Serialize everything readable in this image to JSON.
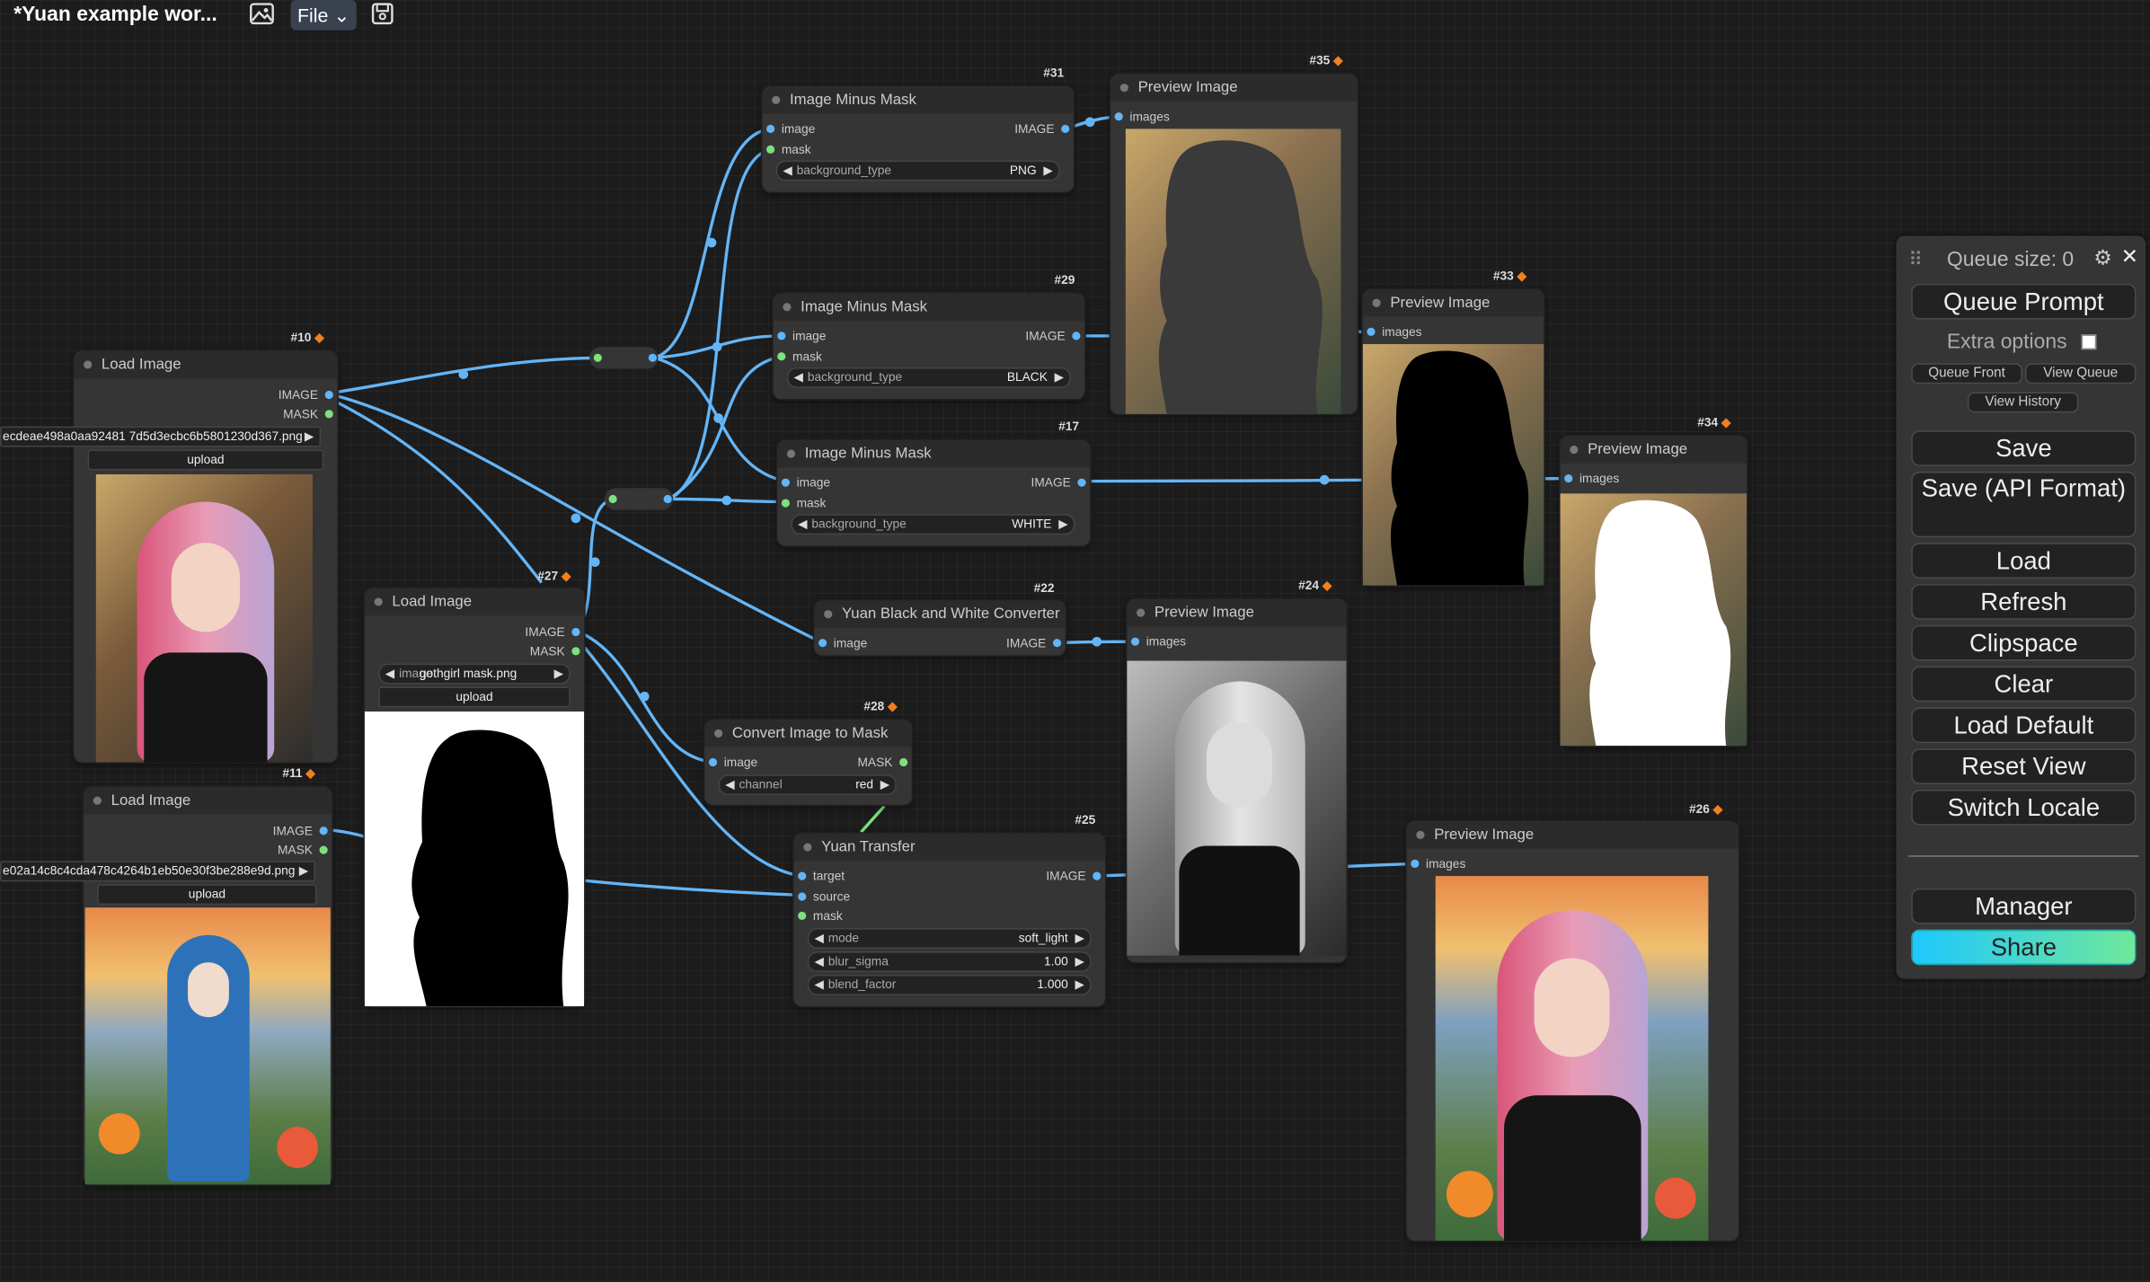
{
  "topbar": {
    "title": "*Yuan example wor...",
    "file_label": "File"
  },
  "nodes": {
    "n10": {
      "id": "#10",
      "title": "Load Image",
      "out_image": "IMAGE",
      "out_mask": "MASK",
      "filename": "ecdeae498a0aa92481 7d5d3ecbc6b5801230d367.png",
      "upload": "upload"
    },
    "n11": {
      "id": "#11",
      "title": "Load Image",
      "out_image": "IMAGE",
      "out_mask": "MASK",
      "filename": "e02a14c8c4cda478c4264b1eb50e30f3be288e9d.png",
      "upload": "upload"
    },
    "n27": {
      "id": "#27",
      "title": "Load Image",
      "out_image": "IMAGE",
      "out_mask": "MASK",
      "image_label": "image",
      "filename": "gothgirl mask.png",
      "upload": "upload"
    },
    "n31": {
      "id": "#31",
      "title": "Image Minus Mask",
      "in_image": "image",
      "in_mask": "mask",
      "out": "IMAGE",
      "w_label": "background_type",
      "w_value": "PNG"
    },
    "n29": {
      "id": "#29",
      "title": "Image Minus Mask",
      "in_image": "image",
      "in_mask": "mask",
      "out": "IMAGE",
      "w_label": "background_type",
      "w_value": "BLACK"
    },
    "n17": {
      "id": "#17",
      "title": "Image Minus Mask",
      "in_image": "image",
      "in_mask": "mask",
      "out": "IMAGE",
      "w_label": "background_type",
      "w_value": "WHITE"
    },
    "n22": {
      "id": "#22",
      "title": "Yuan Black and White Converter",
      "in_image": "image",
      "out": "IMAGE"
    },
    "n28": {
      "id": "#28",
      "title": "Convert Image to Mask",
      "in_image": "image",
      "out": "MASK",
      "w_label": "channel",
      "w_value": "red"
    },
    "n25": {
      "id": "#25",
      "title": "Yuan Transfer",
      "in_target": "target",
      "in_source": "source",
      "in_mask": "mask",
      "out": "IMAGE",
      "w1_label": "mode",
      "w1_value": "soft_light",
      "w2_label": "blur_sigma",
      "w2_value": "1.00",
      "w3_label": "blend_factor",
      "w3_value": "1.000"
    },
    "n35": {
      "id": "#35",
      "title": "Preview Image",
      "in": "images"
    },
    "n33": {
      "id": "#33",
      "title": "Preview Image",
      "in": "images"
    },
    "n34": {
      "id": "#34",
      "title": "Preview Image",
      "in": "images"
    },
    "n24": {
      "id": "#24",
      "title": "Preview Image",
      "in": "images"
    },
    "n26": {
      "id": "#26",
      "title": "Preview Image",
      "in": "images"
    }
  },
  "queue_panel": {
    "queue_size": "Queue size: 0",
    "queue_prompt": "Queue Prompt",
    "extra_options": "Extra options",
    "queue_front": "Queue Front",
    "view_queue": "View Queue",
    "view_history": "View History",
    "save": "Save",
    "save_api": "Save (API Format)",
    "load": "Load",
    "refresh": "Refresh",
    "clipspace": "Clipspace",
    "clear": "Clear",
    "load_default": "Load Default",
    "reset_view": "Reset View",
    "switch_locale": "Switch Locale",
    "manager": "Manager",
    "share": "Share"
  },
  "colors": {
    "wire": "#64b5f6",
    "mask_wire": "#7ee07e",
    "share_gradient": [
      "#1ec8ff",
      "#6fe89a"
    ]
  }
}
